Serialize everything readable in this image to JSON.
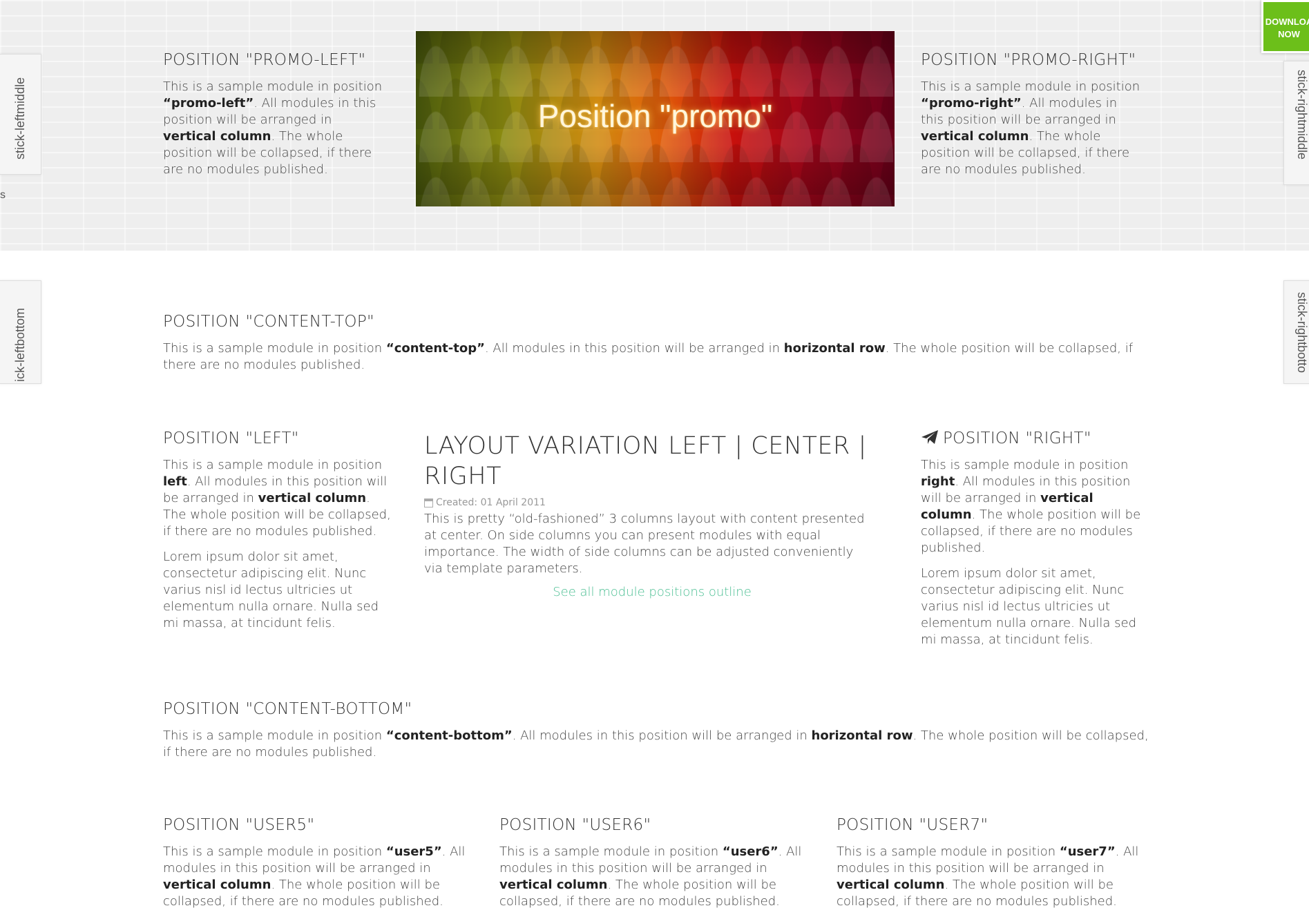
{
  "promo": {
    "left": {
      "title": "POSITION \"PROMO-LEFT\"",
      "t1": "This is a sample module in position ",
      "b1": "“promo-left”",
      "t2": ". All modules in this position will be arranged in ",
      "b2": "vertical column",
      "t3": ". The whole position will be collapsed, if there are no modules published."
    },
    "center_caption": "Position \"promo\"",
    "right": {
      "title": "POSITION \"PROMO-RIGHT\"",
      "t1": "This is a sample module in position ",
      "b1": "“promo-right”",
      "t2": ". All modules in this position will be arranged in ",
      "b2": "vertical column",
      "t3": ". The whole position will be collapsed, if there are no modules published."
    }
  },
  "sticks": {
    "leftmiddle": "stick-leftmiddle",
    "rightmiddle": "stick-rightmiddle",
    "leftbottom": "ick-leftbottom",
    "rightbottom": "stick-rightbotto",
    "stray_letter": "s"
  },
  "download": {
    "line1": "DOWNLOA",
    "line2": "NOW"
  },
  "content_top": {
    "title": "POSITION \"CONTENT-TOP\"",
    "t1": "This is a sample module in position ",
    "b1": "“content-top”",
    "t2": ". All modules in this position will be arranged in ",
    "b2": "horizontal row",
    "t3": ". The whole position will be collapsed, if there are no modules published."
  },
  "left": {
    "title": "POSITION \"LEFT\"",
    "t0": "This is a sample module in position ",
    "b1": "left",
    "t2": ". All modules in this position will be arranged in ",
    "b2": "vertical column",
    "t3": ". The whole position will be collapsed, if there are no modules published.",
    "lorem": "Lorem ipsum dolor sit amet, consectetur adipiscing elit. Nunc varius nisl id lectus ultricies ut elementum nulla ornare. Nulla sed mi massa, at tincidunt felis."
  },
  "center": {
    "title": "LAYOUT VARIATION LEFT | CENTER | RIGHT",
    "created": "Created: 01 April 2011",
    "body": "This is pretty “old-fashioned” 3 columns layout with content presented at center. On side columns you can present modules with equal importance. The width of side columns can be adjusted conveniently via template parameters.",
    "link": "See all module positions outline"
  },
  "right": {
    "title": "POSITION \"RIGHT\"",
    "t0": "This is sample module in position ",
    "b1": "right",
    "t2": ". All modules in this position will be arranged in ",
    "b2": "vertical column",
    "t3": ". The whole position will be collapsed, if there are no modules published.",
    "lorem": "Lorem ipsum dolor sit amet, consectetur adipiscing elit. Nunc varius nisl id lectus ultricies ut elementum nulla ornare. Nulla sed mi massa, at tincidunt felis."
  },
  "content_bottom": {
    "title": "POSITION \"CONTENT-BOTTOM\"",
    "t1": "This is a sample module in position ",
    "b1": "“content-bottom”",
    "t2": ". All modules in this position will be arranged in ",
    "b2": "horizontal row",
    "t3": ". The whole position will be collapsed, if there are no modules published."
  },
  "users": [
    {
      "title": "POSITION \"USER5\"",
      "t1": "This is a sample module in position ",
      "b1": "“user5”",
      "t2": ". All modules in this position will be arranged in ",
      "b2": "vertical column",
      "t3": ". The whole position will be collapsed, if there are no modules published."
    },
    {
      "title": "POSITION \"USER6\"",
      "t1": "This is a sample module in position ",
      "b1": "“user6”",
      "t2": ". All modules in this position will be arranged in ",
      "b2": "vertical column",
      "t3": ". The whole position will be collapsed, if there are no modules published."
    },
    {
      "title": "POSITION \"USER7\"",
      "t1": "This is a sample module in position ",
      "b1": "“user7”",
      "t2": ". All modules in this position will be arranged in ",
      "b2": "vertical column",
      "t3": ". The whole position will be collapsed, if there are no modules published."
    }
  ],
  "colors": {
    "accent_link": "#4cbf93",
    "download_green": "#6cbf1a",
    "promo_band": "#eeeeee"
  }
}
